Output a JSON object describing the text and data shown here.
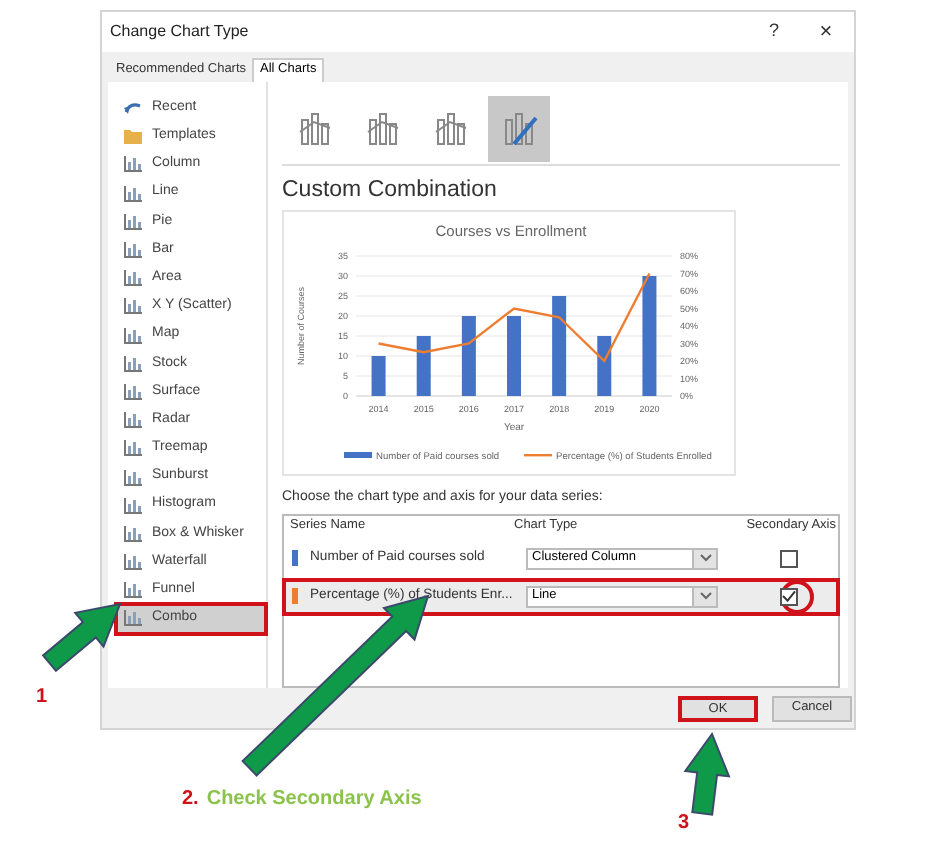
{
  "window": {
    "title": "Change Chart Type",
    "help": "?",
    "close": "×"
  },
  "tabs": [
    {
      "label": "Recommended Charts",
      "selected": false
    },
    {
      "label": "All Charts",
      "selected": true
    }
  ],
  "chart_types": [
    {
      "label": "Recent",
      "selected": false,
      "highlighted": false
    },
    {
      "label": "Templates",
      "selected": false,
      "highlighted": false
    },
    {
      "label": "Column",
      "selected": false,
      "highlighted": false
    },
    {
      "label": "Line",
      "selected": false,
      "highlighted": false
    },
    {
      "label": "Pie",
      "selected": false,
      "highlighted": false
    },
    {
      "label": "Bar",
      "selected": false,
      "highlighted": false
    },
    {
      "label": "Area",
      "selected": false,
      "highlighted": false
    },
    {
      "label": "X Y (Scatter)",
      "selected": false,
      "highlighted": false
    },
    {
      "label": "Map",
      "selected": false,
      "highlighted": false
    },
    {
      "label": "Stock",
      "selected": false,
      "highlighted": false
    },
    {
      "label": "Surface",
      "selected": false,
      "highlighted": false
    },
    {
      "label": "Radar",
      "selected": false,
      "highlighted": false
    },
    {
      "label": "Treemap",
      "selected": false,
      "highlighted": false
    },
    {
      "label": "Sunburst",
      "selected": false,
      "highlighted": false
    },
    {
      "label": "Histogram",
      "selected": false,
      "highlighted": false
    },
    {
      "label": "Box & Whisker",
      "selected": false,
      "highlighted": false
    },
    {
      "label": "Waterfall",
      "selected": false,
      "highlighted": false
    },
    {
      "label": "Funnel",
      "selected": false,
      "highlighted": false
    },
    {
      "label": "Combo",
      "selected": true,
      "highlighted": true
    }
  ],
  "subtypes": [
    {
      "selected": false
    },
    {
      "selected": false
    },
    {
      "selected": false
    },
    {
      "selected": true
    }
  ],
  "heading": "Custom Combination",
  "preview": {
    "chart_data": {
      "type": "bar",
      "title": "Courses vs Enrollment",
      "xlabel": "Year",
      "ylabel": "Number of Courses",
      "categories": [
        "2014",
        "2015",
        "2016",
        "2017",
        "2018",
        "2019",
        "2020"
      ],
      "series": [
        {
          "name": "Number of Paid courses sold",
          "color": "#4472c4",
          "type": "bar",
          "values": [
            10,
            15,
            20,
            20,
            25,
            15,
            30
          ]
        },
        {
          "name": "Percentage (%) of Students Enrolled",
          "color": "#ed7d31",
          "type": "line",
          "axis": "y2",
          "values": [
            30,
            25,
            30,
            50,
            45,
            20,
            70
          ]
        }
      ],
      "grid": true,
      "legend": "bottom",
      "ylim": [
        0,
        35
      ],
      "y2lim": [
        0,
        80
      ],
      "yticks": [
        0,
        5,
        10,
        15,
        20,
        25,
        30,
        35
      ],
      "y2ticks": [
        {
          "value": 0,
          "label": "0%"
        },
        {
          "value": 10,
          "label": "10%"
        },
        {
          "value": 20,
          "label": "20%"
        },
        {
          "value": 30,
          "label": "30%"
        },
        {
          "value": 40,
          "label": "40%"
        },
        {
          "value": 50,
          "label": "50%"
        },
        {
          "value": 60,
          "label": "60%"
        },
        {
          "value": 70,
          "label": "70%"
        },
        {
          "value": 80,
          "label": "80%"
        }
      ]
    }
  },
  "series_prompt": "Choose the chart type and axis for your data series:",
  "series_table": {
    "columns": [
      "Series Name",
      "Chart Type",
      "Secondary Axis"
    ],
    "rows": [
      {
        "name": "Number of Paid courses sold",
        "color": "#4472c4",
        "chart_type": "Clustered Column",
        "secondary_axis": false,
        "highlighted": false
      },
      {
        "name": "Percentage (%) of Students Enr...",
        "color": "#ed7d31",
        "chart_type": "Line",
        "secondary_axis": true,
        "highlighted": true
      }
    ]
  },
  "buttons": [
    {
      "label": "OK",
      "highlighted": true
    },
    {
      "label": "Cancel",
      "highlighted": false
    }
  ],
  "annotations": [
    {
      "number": "1"
    },
    {
      "number": "2.",
      "text": "Check Secondary Axis"
    },
    {
      "number": "3"
    }
  ]
}
